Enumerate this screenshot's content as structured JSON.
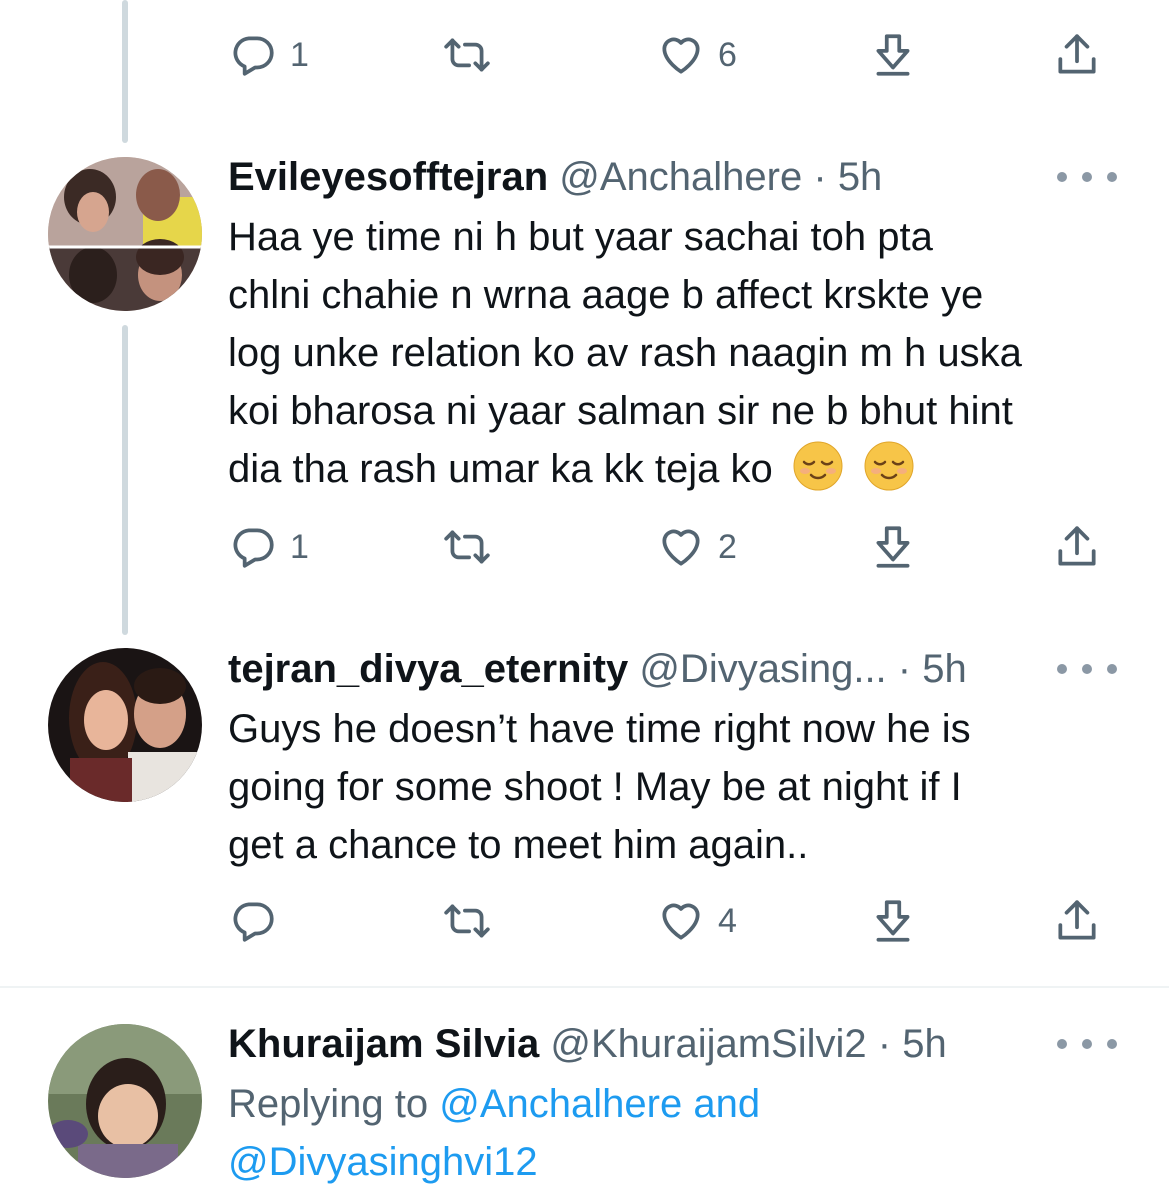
{
  "tweets": [
    {
      "actions": {
        "reply_count": "1",
        "retweet_count": "",
        "like_count": "6"
      }
    },
    {
      "display_name": "Evileyesofftejran",
      "handle": "@Anchalhere",
      "separator": "·",
      "time": "5h",
      "lines": [
        "Haa ye time ni h but yaar sachai toh pta",
        "chlni chahie n wrna aage b affect krskte ye",
        "log unke relation ko av rash naagin m h uska",
        "koi bharosa ni yaar salman sir ne b bhut hint",
        "dia tha rash umar ka kk teja ko"
      ],
      "emoji": [
        "relieved-face-emoji",
        "relieved-face-emoji"
      ],
      "actions": {
        "reply_count": "1",
        "retweet_count": "",
        "like_count": "2"
      }
    },
    {
      "display_name": "tejran_divya_eternity",
      "handle": "@Divyasing...",
      "separator": "·",
      "time": "5h",
      "lines": [
        "Guys he doesn’t have time right now he is",
        "going for some shoot ! May be at night if I",
        "get a chance to meet him again.."
      ],
      "actions": {
        "reply_count": "",
        "retweet_count": "",
        "like_count": "4"
      }
    },
    {
      "display_name": "Khuraijam Silvia",
      "handle": "@KhuraijamSilvi2",
      "separator": "·",
      "time": "5h",
      "replying_prefix": "Replying to",
      "replying_mention": "@Anchalhere and",
      "replying_mention_2": "@Divyasinghvi12"
    }
  ],
  "colors": {
    "text": "#0f1419",
    "secondary": "#536471",
    "link": "#1d9bf0",
    "thread_line": "#cfd9de"
  },
  "icons": [
    "reply-icon",
    "retweet-icon",
    "like-icon",
    "download-icon",
    "share-icon",
    "more-icon"
  ]
}
